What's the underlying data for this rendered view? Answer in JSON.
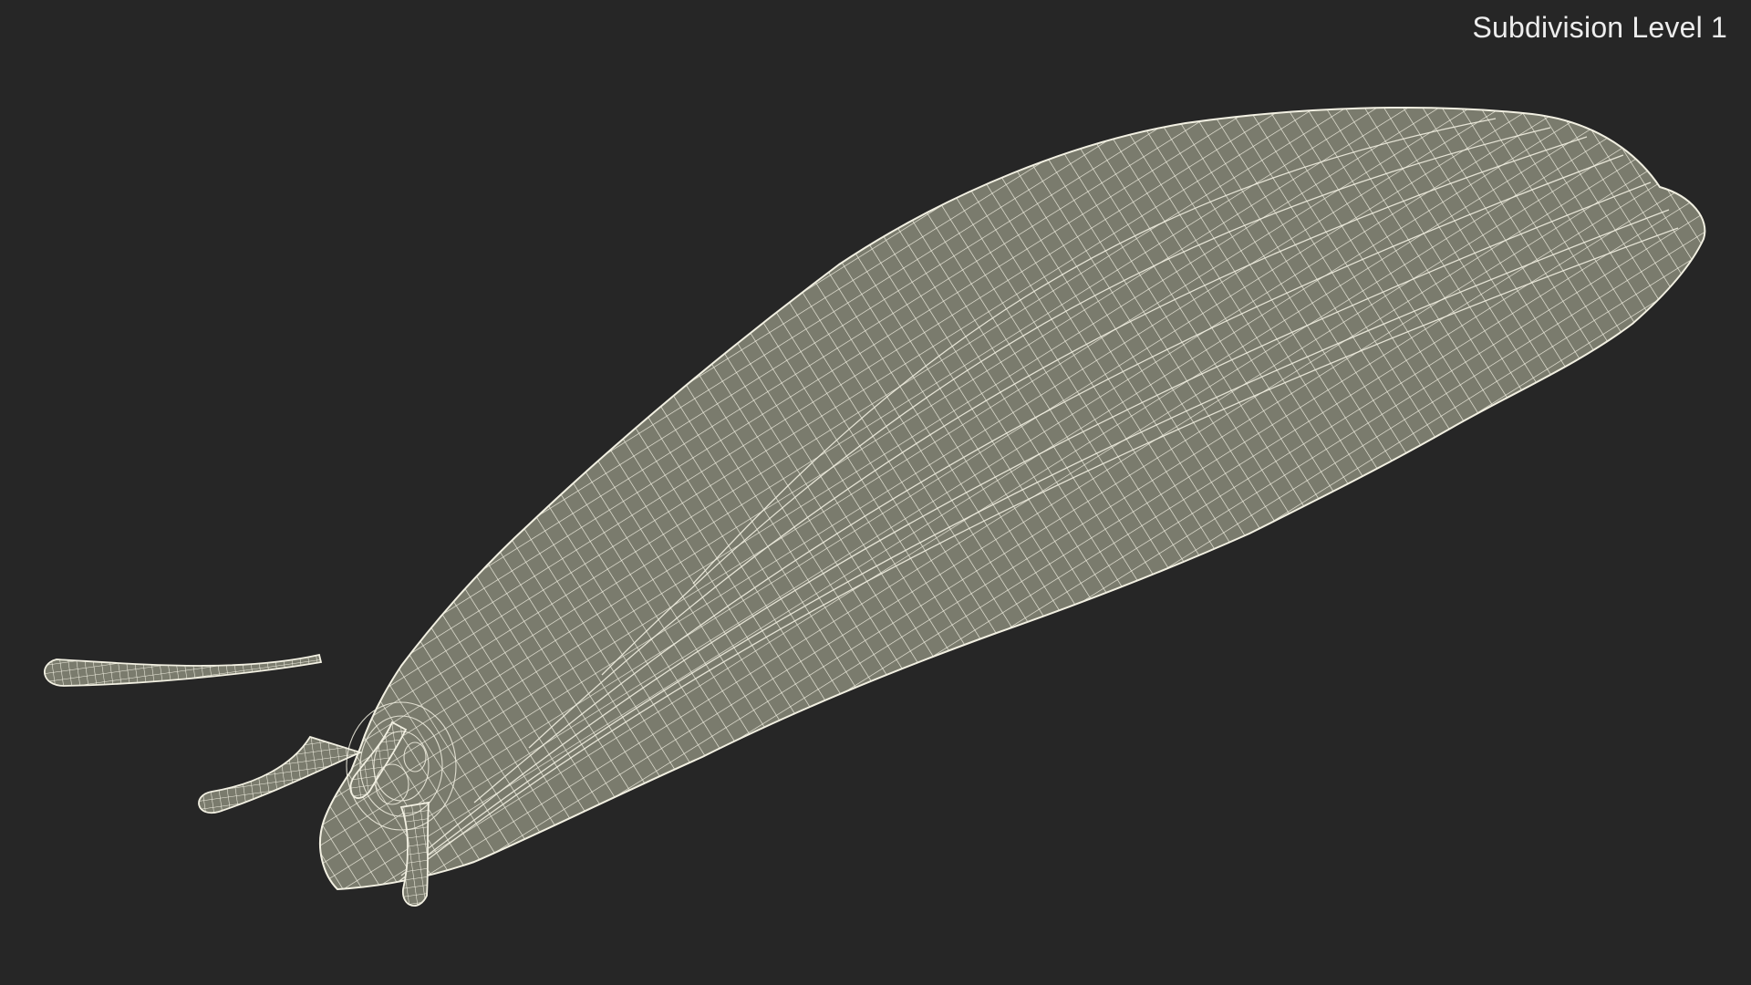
{
  "viewport": {
    "label": "Subdivision Level 1",
    "background_color": "#262626",
    "surface_color": "#7a7b6d",
    "wire_color": "#f2f0e2"
  },
  "model": {
    "subject": "slug",
    "display_mode": "wireframe-on-shaded"
  }
}
